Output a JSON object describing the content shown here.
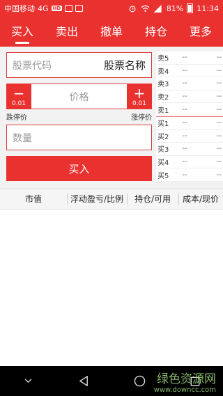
{
  "status_bar": {
    "carrier": "中国移动",
    "network": "4G",
    "hd_badge": "HD",
    "battery": "81%",
    "time": "11:34",
    "signal_label": "4G"
  },
  "tabs": [
    {
      "label": "买入",
      "active": true
    },
    {
      "label": "卖出",
      "active": false
    },
    {
      "label": "撤单",
      "active": false
    },
    {
      "label": "持仓",
      "active": false
    },
    {
      "label": "更多",
      "active": false
    }
  ],
  "form": {
    "stock_code_placeholder": "股票代码",
    "stock_name": "股票名称",
    "price_placeholder": "价格",
    "minus_symbol": "−",
    "plus_symbol": "+",
    "minus_step": "0.01",
    "plus_step": "0.01",
    "limit_down_label": "跌停价",
    "limit_up_label": "涨停价",
    "quantity_placeholder": "数量",
    "buy_button": "买入"
  },
  "order_book": {
    "sell": [
      {
        "label": "卖5",
        "price": "--",
        "volume": "--"
      },
      {
        "label": "卖4",
        "price": "--",
        "volume": "--"
      },
      {
        "label": "卖3",
        "price": "--",
        "volume": "--"
      },
      {
        "label": "卖2",
        "price": "--",
        "volume": "--"
      },
      {
        "label": "卖1",
        "price": "--",
        "volume": "--"
      }
    ],
    "buy": [
      {
        "label": "买1",
        "price": "--",
        "volume": "--"
      },
      {
        "label": "买2",
        "price": "--",
        "volume": "--"
      },
      {
        "label": "买3",
        "price": "--",
        "volume": "--"
      },
      {
        "label": "买4",
        "price": "--",
        "volume": "--"
      },
      {
        "label": "买5",
        "price": "--",
        "volume": "--"
      }
    ]
  },
  "holdings_header": [
    "市值",
    "浮动盈亏/比例",
    "持仓/可用",
    "成本/现价"
  ],
  "watermark": {
    "text": "绿色资源网",
    "url": "www.downcc.com"
  },
  "colors": {
    "accent": "#e9312f"
  }
}
